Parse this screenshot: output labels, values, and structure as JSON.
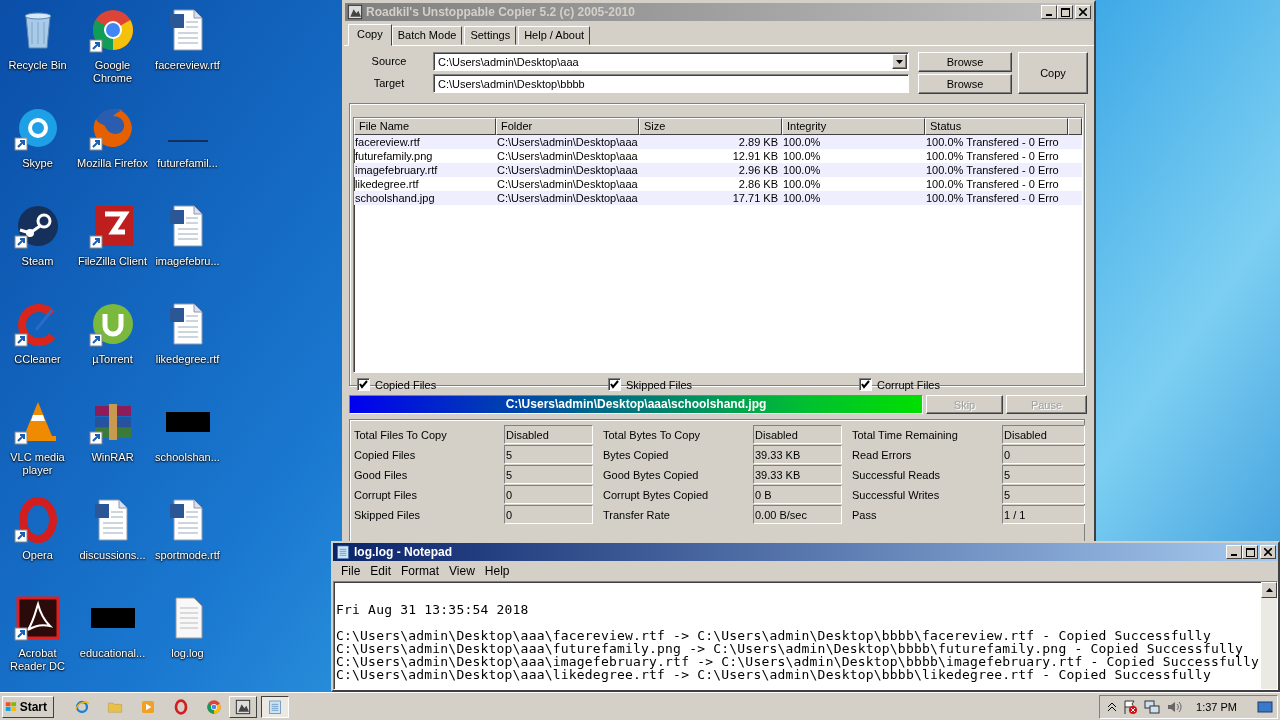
{
  "desktop": {
    "icons": [
      {
        "label": "Recycle Bin",
        "kind": "recycle",
        "shortcut": false
      },
      {
        "label": "Skype",
        "kind": "skype",
        "shortcut": true
      },
      {
        "label": "Steam",
        "kind": "steam",
        "shortcut": true
      },
      {
        "label": "CCleaner",
        "kind": "ccleaner",
        "shortcut": true
      },
      {
        "label": "VLC media player",
        "kind": "vlc",
        "shortcut": true
      },
      {
        "label": "Opera",
        "kind": "opera",
        "shortcut": true
      },
      {
        "label": "Acrobat Reader DC",
        "kind": "acrobat",
        "shortcut": true
      },
      {
        "label": "Google Chrome",
        "kind": "chrome",
        "shortcut": true
      },
      {
        "label": "Mozilla Firefox",
        "kind": "firefox",
        "shortcut": true
      },
      {
        "label": "FileZilla Client",
        "kind": "filezilla",
        "shortcut": true
      },
      {
        "label": "µTorrent",
        "kind": "utorrent",
        "shortcut": true
      },
      {
        "label": "WinRAR",
        "kind": "winrar",
        "shortcut": true
      },
      {
        "label": "discussions...",
        "kind": "doc",
        "shortcut": false
      },
      {
        "label": "educational...",
        "kind": "thumb_black",
        "shortcut": false
      },
      {
        "label": "facereview.rtf",
        "kind": "doc",
        "shortcut": false
      },
      {
        "label": "futurefamil...",
        "kind": "thumb_blank",
        "shortcut": false
      },
      {
        "label": "imagefebru...",
        "kind": "doc",
        "shortcut": false
      },
      {
        "label": "likedegree.rtf",
        "kind": "doc",
        "shortcut": false
      },
      {
        "label": "schoolshan...",
        "kind": "thumb_black",
        "shortcut": false
      },
      {
        "label": "sportmode.rtf",
        "kind": "doc",
        "shortcut": false
      },
      {
        "label": "log.log",
        "kind": "text",
        "shortcut": false
      }
    ]
  },
  "copier": {
    "title": "Roadkil's Unstoppable Copier 5.2 (c) 2005-2010",
    "tabs": [
      {
        "label": "Copy",
        "selected": true
      },
      {
        "label": "Batch Mode",
        "selected": false
      },
      {
        "label": "Settings",
        "selected": false
      },
      {
        "label": "Help / About",
        "selected": false
      }
    ],
    "source": {
      "label": "Source",
      "value": "C:\\Users\\admin\\Desktop\\aaa"
    },
    "target": {
      "label": "Target",
      "value": "C:\\Users\\admin\\Desktop\\bbbb"
    },
    "browse_buttons": [
      "Browse",
      "Browse"
    ],
    "copy_button": "Copy",
    "columns": [
      "File Name",
      "Folder",
      "Size",
      "Integrity",
      "Status"
    ],
    "rows": [
      [
        "facereview.rtf",
        "C:\\Users\\admin\\Desktop\\aaa",
        "2.89 KB",
        "100.0%",
        "100.0% Transfered - 0 Erro"
      ],
      [
        "futurefamily.png",
        "C:\\Users\\admin\\Desktop\\aaa",
        "12.91 KB",
        "100.0%",
        "100.0% Transfered - 0 Erro"
      ],
      [
        "imagefebruary.rtf",
        "C:\\Users\\admin\\Desktop\\aaa",
        "2.96 KB",
        "100.0%",
        "100.0% Transfered - 0 Erro"
      ],
      [
        "likedegree.rtf",
        "C:\\Users\\admin\\Desktop\\aaa",
        "2.86 KB",
        "100.0%",
        "100.0% Transfered - 0 Erro"
      ],
      [
        "schoolshand.jpg",
        "C:\\Users\\admin\\Desktop\\aaa",
        "17.71 KB",
        "100.0%",
        "100.0% Transfered - 0 Erro"
      ]
    ],
    "filters": [
      {
        "label": "Copied Files",
        "checked": true
      },
      {
        "label": "Skipped Files",
        "checked": true
      },
      {
        "label": "Corrupt Files",
        "checked": true
      }
    ],
    "progress": {
      "path": "C:\\Users\\admin\\Desktop\\aaa\\schoolshand.jpg",
      "level": 1
    },
    "controls": [
      {
        "label": "Skip",
        "disabled": true
      },
      {
        "label": "Pause",
        "disabled": true
      }
    ],
    "stats": [
      [
        {
          "label": "Total Files To Copy",
          "value": "Disabled"
        },
        {
          "label": "Copied Files",
          "value": "5"
        },
        {
          "label": "Good Files",
          "value": "5"
        },
        {
          "label": "Corrupt Files",
          "value": "0"
        },
        {
          "label": "Skipped Files",
          "value": "0"
        }
      ],
      [
        {
          "label": "Total Bytes To Copy",
          "value": "Disabled"
        },
        {
          "label": "Bytes Copied",
          "value": "39.33 KB"
        },
        {
          "label": "Good Bytes Copied",
          "value": "39.33 KB"
        },
        {
          "label": "Corrupt Bytes Copied",
          "value": "0 B"
        },
        {
          "label": "Transfer Rate",
          "value": "0.00 B/sec"
        }
      ],
      [
        {
          "label": "Total Time Remaining",
          "value": "Disabled"
        },
        {
          "label": "Read Errors",
          "value": "0"
        },
        {
          "label": "Successful Reads",
          "value": "5"
        },
        {
          "label": "Successful Writes",
          "value": "5"
        },
        {
          "label": "Pass",
          "value": "1 / 1"
        }
      ]
    ]
  },
  "notepad": {
    "title": "log.log - Notepad",
    "menu": [
      "File",
      "Edit",
      "Format",
      "View",
      "Help"
    ],
    "date_line": "Fri Aug 31 13:35:54 2018",
    "lines": [
      "C:\\Users\\admin\\Desktop\\aaa\\facereview.rtf -> C:\\Users\\admin\\Desktop\\bbbb\\facereview.rtf - Copied Successfully",
      "C:\\Users\\admin\\Desktop\\aaa\\futurefamily.png -> C:\\Users\\admin\\Desktop\\bbbb\\futurefamily.png - Copied Successfully",
      "C:\\Users\\admin\\Desktop\\aaa\\imagefebruary.rtf -> C:\\Users\\admin\\Desktop\\bbbb\\imagefebruary.rtf - Copied Successfully",
      "C:\\Users\\admin\\Desktop\\aaa\\likedegree.rtf -> C:\\Users\\admin\\Desktop\\bbbb\\likedegree.rtf - Copied Successfully"
    ]
  },
  "taskbar": {
    "start": "Start",
    "quick_launch": [
      {
        "kind": "ie"
      },
      {
        "kind": "folder"
      },
      {
        "kind": "media"
      },
      {
        "kind": "opera"
      },
      {
        "kind": "chrome"
      }
    ],
    "tasks": [
      {
        "kind": "copier",
        "selected": false
      },
      {
        "kind": "notepad",
        "selected": true
      }
    ],
    "clock": "1:37 PM"
  }
}
